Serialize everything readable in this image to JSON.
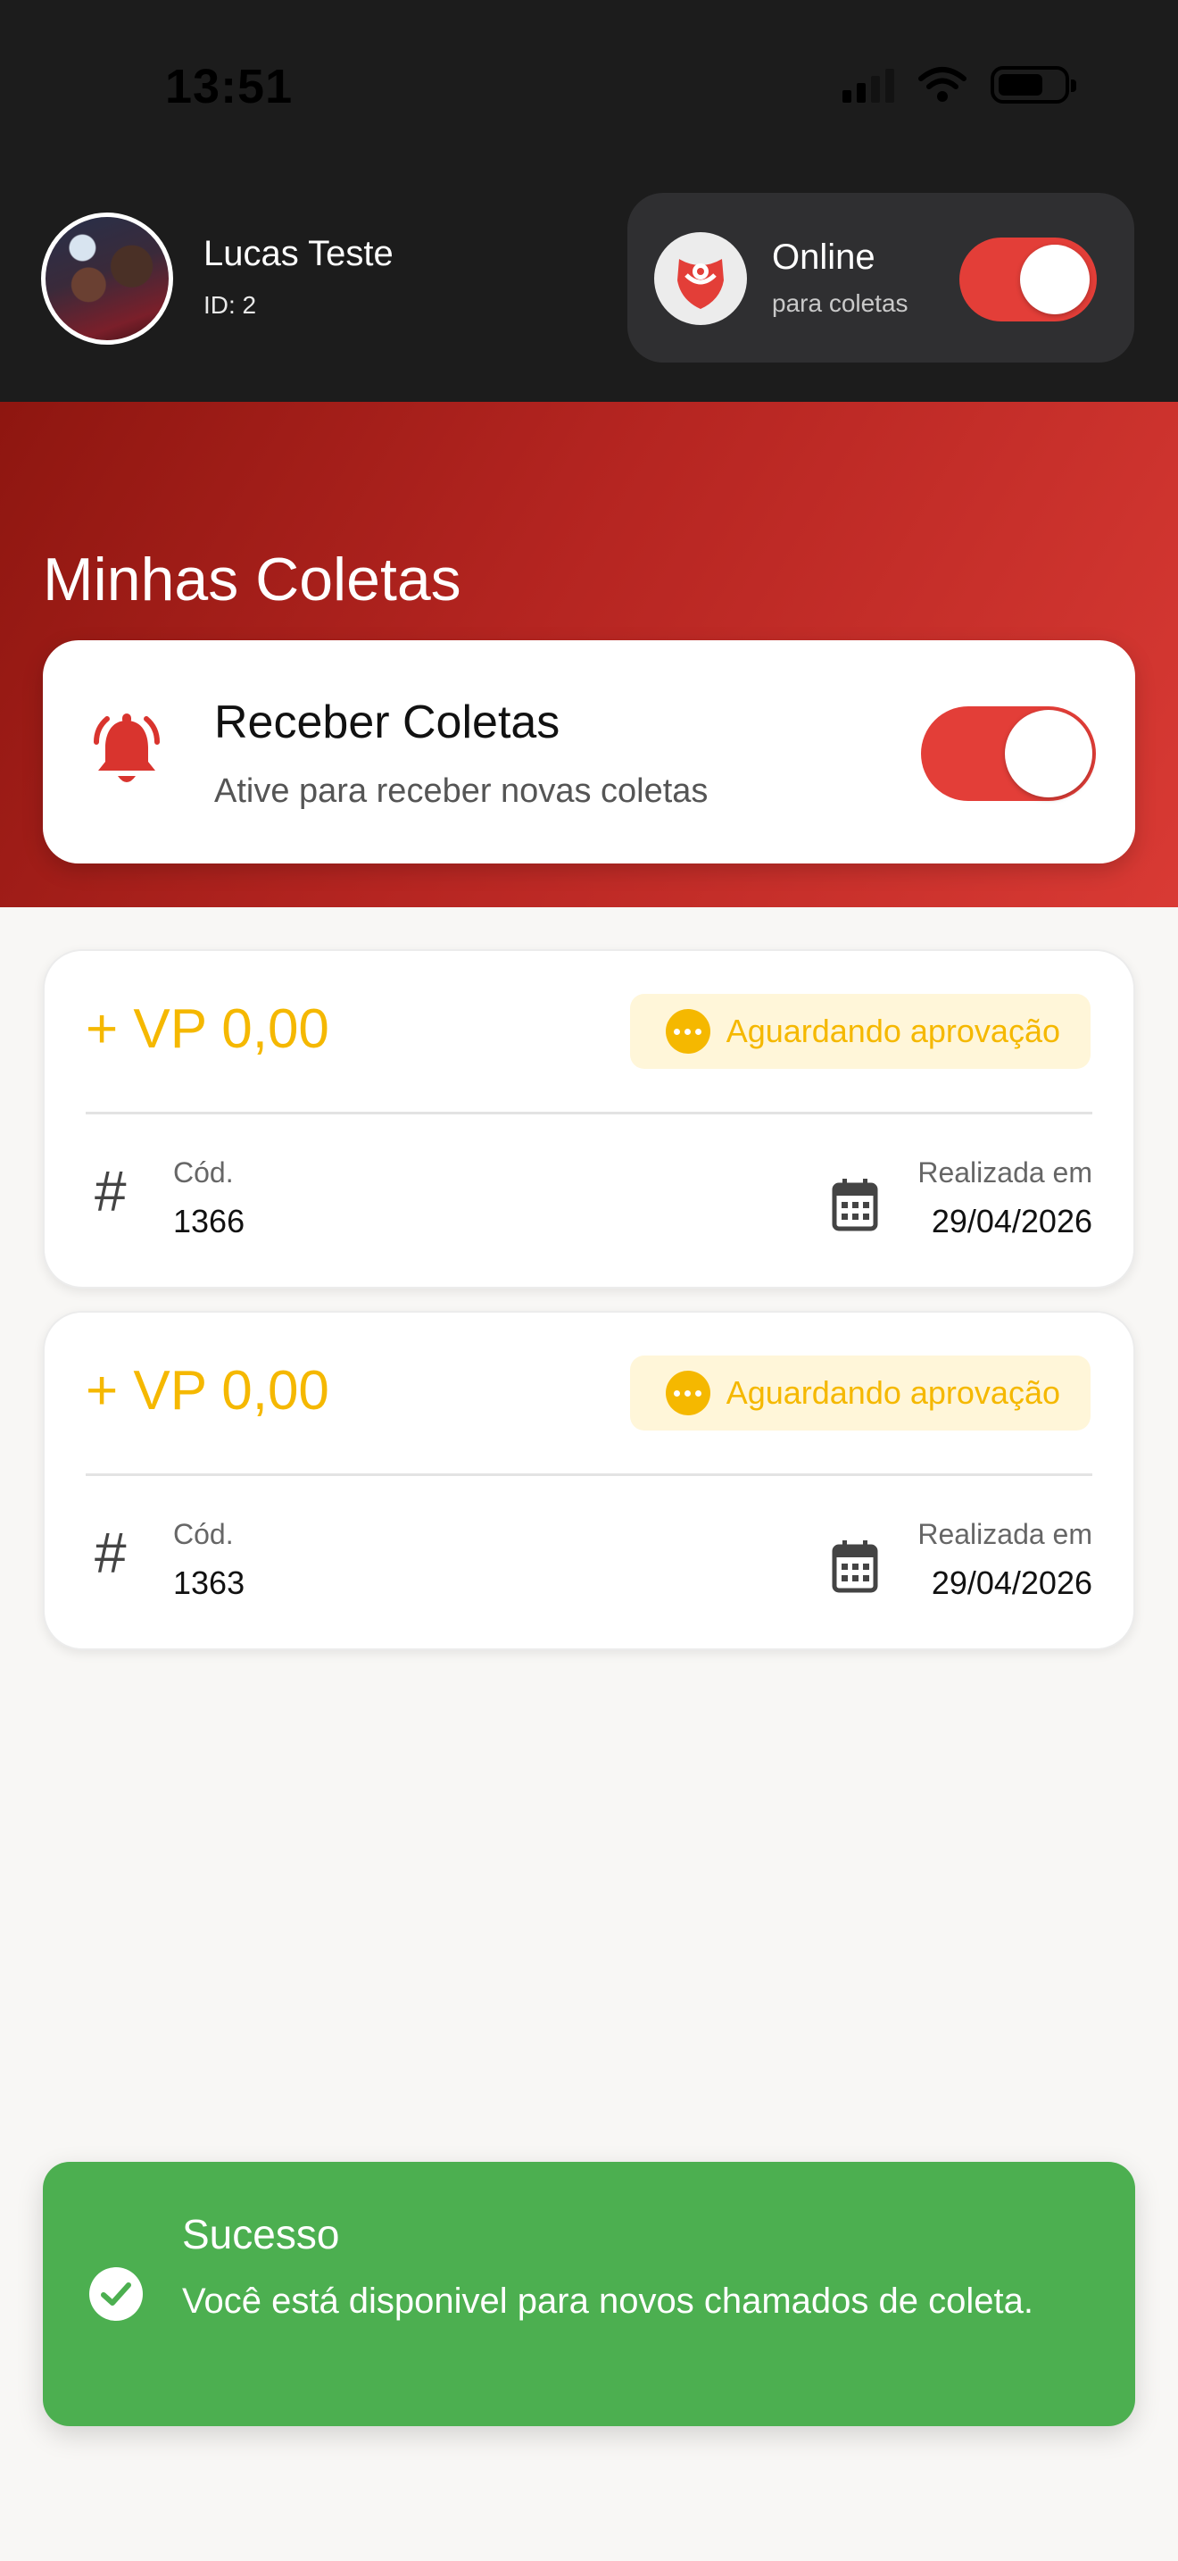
{
  "status_bar": {
    "time": "13:51",
    "icons": [
      "cellular-signal-icon",
      "wifi-icon",
      "battery-icon"
    ]
  },
  "user": {
    "name": "Lucas Teste",
    "id_label": "ID: 2"
  },
  "online": {
    "title": "Online",
    "subtitle": "para coletas",
    "toggle_on": true
  },
  "page": {
    "title": "Minhas Coletas"
  },
  "receive": {
    "title": "Receber Coletas",
    "subtitle": "Ative para receber novas coletas",
    "toggle_on": true,
    "icon": "bell-icon"
  },
  "coletas": [
    {
      "amount": "+ VP 0,00",
      "status": "Aguardando aprovação",
      "cod_label": "Cód.",
      "cod": "1366",
      "date_label": "Realizada em",
      "date": "29/04/2026"
    },
    {
      "amount": "+ VP 0,00",
      "status": "Aguardando aprovação",
      "cod_label": "Cód.",
      "cod": "1363",
      "date_label": "Realizada em",
      "date": "29/04/2026"
    }
  ],
  "toast": {
    "title": "Sucesso",
    "message": "Você está disponivel para novos chamados de coleta.",
    "icon": "check-circle-icon"
  },
  "colors": {
    "accent_red": "#e33e38",
    "amount_yellow": "#f5b800",
    "success_green": "#4caf50",
    "header_dark": "#1c1c1c"
  }
}
